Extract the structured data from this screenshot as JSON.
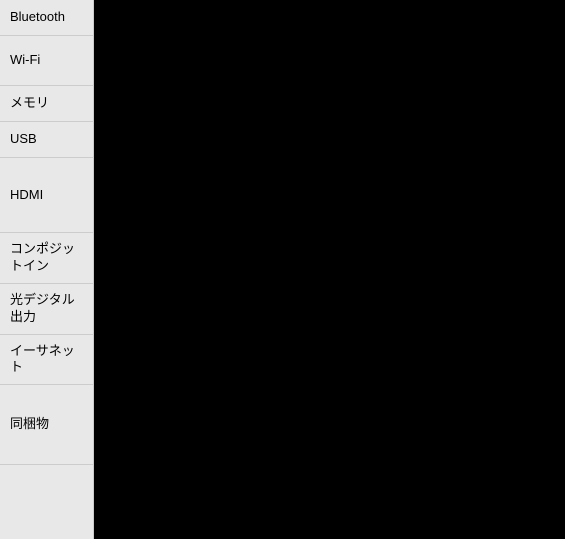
{
  "sidebar": {
    "items": [
      {
        "id": "bluetooth",
        "label": "Bluetooth"
      },
      {
        "id": "wifi",
        "label": "Wi-Fi"
      },
      {
        "id": "memory",
        "label": "メモリ"
      },
      {
        "id": "usb",
        "label": "USB"
      },
      {
        "id": "hdmi",
        "label": "HDMI"
      },
      {
        "id": "composite-in",
        "label": "コンポジットイン"
      },
      {
        "id": "optical-out",
        "label": "光デジタル出力"
      },
      {
        "id": "ethernet",
        "label": "イーサネット"
      },
      {
        "id": "accessories",
        "label": "同梱物"
      }
    ]
  }
}
